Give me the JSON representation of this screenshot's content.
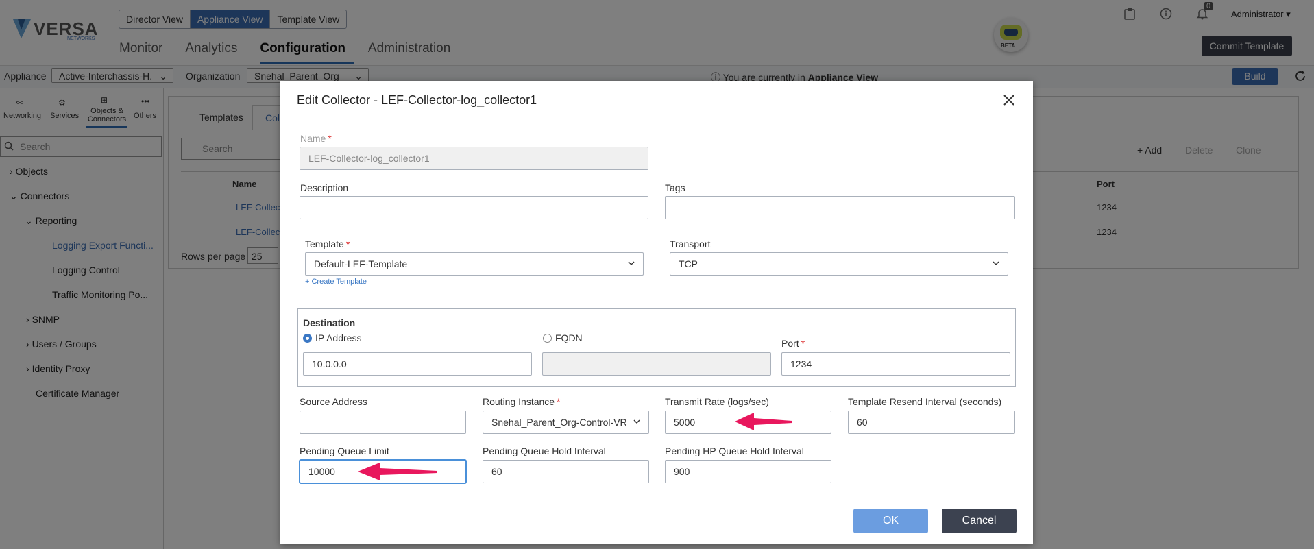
{
  "brand": {
    "name": "VERSA",
    "sub": "NETWORKS"
  },
  "view_switch": [
    "Director View",
    "Appliance View",
    "Template View"
  ],
  "main_nav": [
    "Monitor",
    "Analytics",
    "Configuration",
    "Administration"
  ],
  "header_right": {
    "notifications": "0",
    "user": "Administrator",
    "commit": "Commit Template",
    "bot_badge": "BETA"
  },
  "subbar": {
    "appliance_label": "Appliance",
    "appliance_value": "Active-Interchassis-H.",
    "org_label": "Organization",
    "org_value": "Snehal_Parent_Org",
    "info_prefix": "You are currently in ",
    "info_bold": "Appliance View",
    "build": "Build"
  },
  "sidebar": {
    "tabs": [
      "Networking",
      "Services",
      "Objects & Connectors",
      "Others"
    ],
    "search_placeholder": "Search",
    "tree": [
      "Objects",
      "Connectors",
      "Reporting",
      "Logging Export Functi...",
      "Logging Control",
      "Traffic Monitoring Po...",
      "SNMP",
      "Users / Groups",
      "Identity Proxy",
      "Certificate Manager"
    ]
  },
  "content": {
    "tabs": [
      "Templates",
      "Coll"
    ],
    "search_placeholder": "Search",
    "actions": [
      "+ Add",
      "Delete",
      "Clone"
    ],
    "col_name": "Name",
    "col_port": "Port",
    "rows": [
      {
        "name": "LEF-Collect",
        "port": "1234"
      },
      {
        "name": "LEF-Collect",
        "port": "1234"
      }
    ],
    "rows_per_page_label": "Rows per page",
    "rows_per_page": "25"
  },
  "modal": {
    "title": "Edit Collector - LEF-Collector-log_collector1",
    "name_label": "Name",
    "name_value": "LEF-Collector-log_collector1",
    "description_label": "Description",
    "description_value": "",
    "tags_label": "Tags",
    "tags_value": "",
    "template_label": "Template",
    "template_value": "Default-LEF-Template",
    "create_template": "+ Create Template",
    "transport_label": "Transport",
    "transport_value": "TCP",
    "destination_label": "Destination",
    "ip_label": "IP Address",
    "fqdn_label": "FQDN",
    "ip_value": "10.0.0.0",
    "fqdn_value": "",
    "port_label": "Port",
    "port_value": "1234",
    "source_label": "Source Address",
    "source_value": "",
    "routing_label": "Routing Instance",
    "routing_value": "Snehal_Parent_Org-Control-VR",
    "transmit_label": "Transmit Rate (logs/sec)",
    "transmit_value": "5000",
    "resend_label": "Template Resend Interval (seconds)",
    "resend_value": "60",
    "pql_label": "Pending Queue Limit",
    "pql_value": "10000",
    "pqhi_label": "Pending Queue Hold Interval",
    "pqhi_value": "60",
    "phpq_label": "Pending HP Queue Hold Interval",
    "phpq_value": "900",
    "ok": "OK",
    "cancel": "Cancel"
  },
  "colors": {
    "accent": "#3b6db3",
    "arrow": "#e8175d",
    "ok": "#6b9de0",
    "cancel": "#3c4250"
  }
}
